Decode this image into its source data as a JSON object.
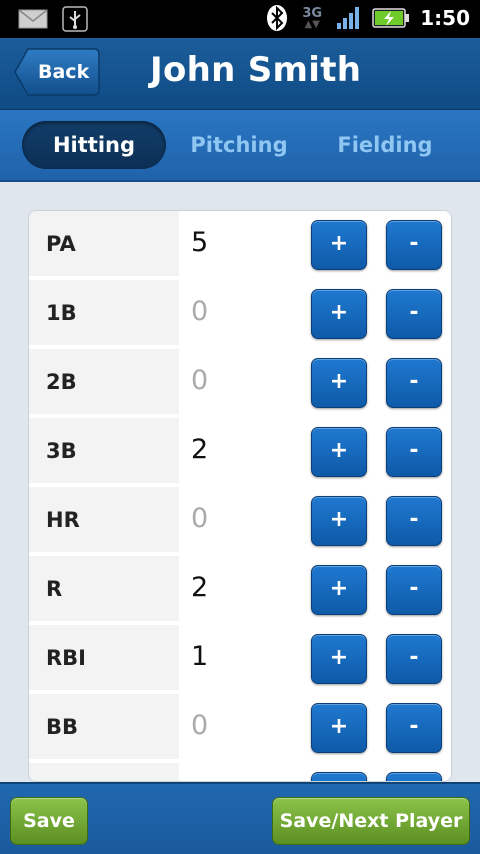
{
  "status_bar": {
    "icons": [
      "mail-icon",
      "usb-icon",
      "bluetooth-icon",
      "signal-icon",
      "battery-icon"
    ],
    "network": "3G",
    "time": "1:50"
  },
  "header": {
    "back_label": "Back",
    "title": "John Smith"
  },
  "tabs": [
    {
      "label": "Hitting",
      "active": true
    },
    {
      "label": "Pitching",
      "active": false
    },
    {
      "label": "Fielding",
      "active": false
    }
  ],
  "stats": [
    {
      "label": "PA",
      "value": "5"
    },
    {
      "label": "1B",
      "value": "0"
    },
    {
      "label": "2B",
      "value": "0"
    },
    {
      "label": "3B",
      "value": "2"
    },
    {
      "label": "HR",
      "value": "0"
    },
    {
      "label": "R",
      "value": "2"
    },
    {
      "label": "RBI",
      "value": "1"
    },
    {
      "label": "BB",
      "value": "0"
    },
    {
      "label": "",
      "value": ""
    }
  ],
  "buttons": {
    "plus": "+",
    "minus": "-"
  },
  "footer": {
    "save_label": "Save",
    "save_next_label": "Save/Next Player"
  },
  "colors": {
    "header_blue": "#1b5d9a",
    "tab_blue": "#2a75c2",
    "button_blue": "#1f79d0",
    "save_green": "#7db540"
  }
}
